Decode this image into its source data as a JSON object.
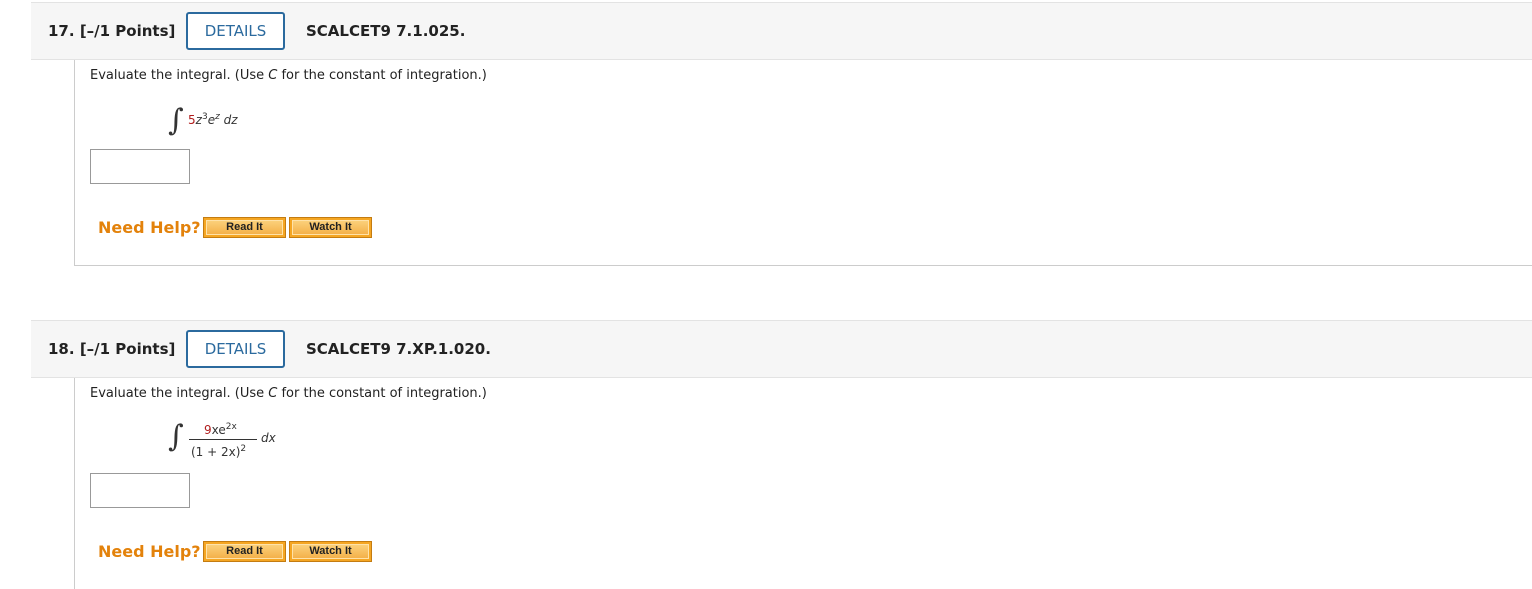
{
  "questions": [
    {
      "number": "17.",
      "points": "[–/1 Points]",
      "details_label": "DETAILS",
      "code": "SCALCET9 7.1.025.",
      "prompt_before": "Evaluate the integral. (Use ",
      "prompt_var": "C",
      "prompt_after": " for the constant of integration.)",
      "integrand": {
        "coef": "5",
        "var": "z",
        "exp": "3",
        "base": "e",
        "base_exp": "z",
        "differential": "dz"
      },
      "answer_value": "",
      "need_help": "Need Help?",
      "read_it": "Read It",
      "watch_it": "Watch It"
    },
    {
      "number": "18.",
      "points": "[–/1 Points]",
      "details_label": "DETAILS",
      "code": "SCALCET9 7.XP.1.020.",
      "prompt_before": "Evaluate the integral. (Use ",
      "prompt_var": "C",
      "prompt_after": " for the constant of integration.)",
      "integrand": {
        "num_coef": "9",
        "num_rest": "xe",
        "num_exp": "2x",
        "den": "(1 + 2x)",
        "den_exp": "2",
        "differential": "dx"
      },
      "answer_value": "",
      "need_help": "Need Help?",
      "read_it": "Read It",
      "watch_it": "Watch It"
    }
  ],
  "colors": {
    "details_blue": "#2b6a9e",
    "need_help_orange": "#e3820b",
    "button_orange": "#f5a623",
    "coef_red": "#b01c1c"
  }
}
